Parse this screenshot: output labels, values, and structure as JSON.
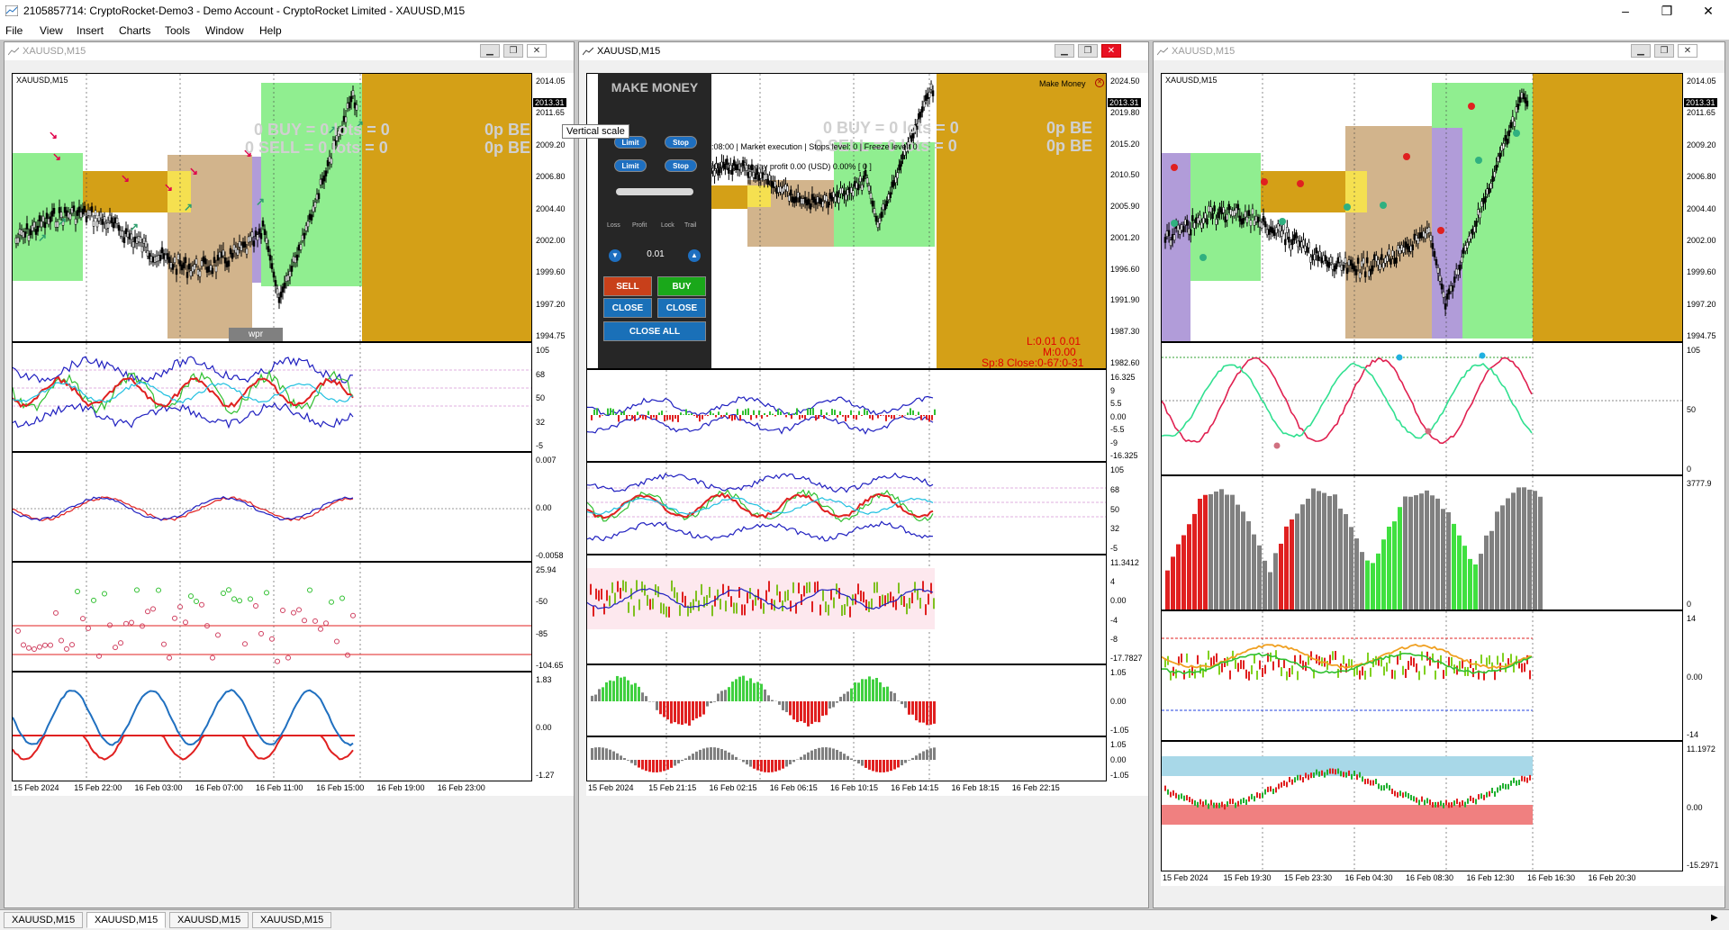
{
  "app": {
    "title": "2105857714: CryptoRocket-Demo3 - Demo Account - CryptoRocket Limited - XAUUSD,M15",
    "minimize": "–",
    "maximize": "❐",
    "close": "✕"
  },
  "menu": [
    "File",
    "View",
    "Insert",
    "Charts",
    "Tools",
    "Window",
    "Help"
  ],
  "colors": {
    "green_zone": "#90ee90",
    "orange_zone": "#d4a017",
    "tan_zone": "#d2b48c",
    "purple_zone": "#b19cd9",
    "bull": "#00c000",
    "bear": "#e00000"
  },
  "windows": [
    {
      "title": "XAUUSD,M15",
      "symbol_label": "XAUUSD,M15",
      "overlay": [
        "0 BUY = 0 lots = 0",
        "0 SELL = 0 lots = 0",
        "0p BE",
        "0p BE"
      ],
      "wpr_label": "wpr",
      "price_ticks": [
        "2014.05",
        "2011.65",
        "2009.20",
        "2006.80",
        "2004.40",
        "2002.00",
        "1999.60",
        "1997.20",
        "1994.75"
      ],
      "current_price": "2013.31",
      "ind1_ticks": [
        "105",
        "68",
        "50",
        "32",
        "-5"
      ],
      "ind1_extra": "00",
      "ind2_ticks": [
        "0.007",
        "0.00",
        "-0.0058"
      ],
      "ind3_ticks": [
        "25.94",
        "-50",
        "-85",
        "-104.65"
      ],
      "ind4_ticks": [
        "1.83",
        "0.00",
        "-1.27"
      ],
      "time_labels": [
        "15 Feb 2024",
        "15 Feb 22:00",
        "16 Feb 03:00",
        "16 Feb 07:00",
        "16 Feb 11:00",
        "16 Feb 15:00",
        "16 Feb 19:00",
        "16 Feb 23:00"
      ]
    },
    {
      "title": "XAUUSD,M15",
      "overlay": [
        "0 BUY = 0 lots = 0",
        "0 SELL = 0 lots = 0",
        "0p BE",
        "0p BE"
      ],
      "make_money_label": "Make Money",
      "info_line1": "01:08:00 | Market execution | Stops level: 0 | Freeze level: 0",
      "info_line2": "0.00% [ 0 ] | today profit 0.00 (USD)  0.00% [ 0 ]",
      "status": [
        "L:0.01 0.01",
        "M:0.00",
        "Sp:8   Close:0-67:0-31"
      ],
      "price_ticks": [
        "2024.50",
        "2019.80",
        "2015.20",
        "2010.50",
        "2005.90",
        "2001.20",
        "1996.60",
        "1991.90",
        "1987.30",
        "1982.60"
      ],
      "current_price": "2013.31",
      "ind1_ticks": [
        "16.325",
        "9",
        "5.5",
        "0.00",
        "-5.5",
        "-9",
        "-16.325"
      ],
      "ind2_ticks": [
        "105",
        "68",
        "50",
        "32",
        "-5"
      ],
      "ind2_extra": "00",
      "ind3_ticks": [
        "11.3412",
        "4",
        "0.00",
        "-4",
        "-8",
        "-17.7827"
      ],
      "ind4_ticks": [
        "1.05",
        "0.00",
        "-1.05"
      ],
      "ind5_ticks": [
        "1.05",
        "0.00",
        "-1.05"
      ],
      "time_labels": [
        "15 Feb 2024",
        "15 Feb 21:15",
        "16 Feb 02:15",
        "16 Feb 06:15",
        "16 Feb 10:15",
        "16 Feb 14:15",
        "16 Feb 18:15",
        "16 Feb 22:15"
      ]
    },
    {
      "title": "XAUUSD,M15",
      "symbol_label": "XAUUSD,M15",
      "price_ticks": [
        "2014.05",
        "2011.65",
        "2009.20",
        "2006.80",
        "2004.40",
        "2002.00",
        "1999.60",
        "1997.20",
        "1994.75"
      ],
      "current_price": "2013.31",
      "ind1_ticks": [
        "105",
        "50",
        "0"
      ],
      "ind2_ticks": [
        "3777.9",
        "0"
      ],
      "ind3_ticks": [
        "14",
        "0.00",
        "-14"
      ],
      "ind4_ticks": [
        "11.1972",
        "0.00",
        "-15.2971"
      ],
      "time_labels": [
        "15 Feb 2024",
        "15 Feb 19:30",
        "15 Feb 23:30",
        "16 Feb 04:30",
        "16 Feb 08:30",
        "16 Feb 12:30",
        "16 Feb 16:30",
        "16 Feb 20:30"
      ]
    }
  ],
  "panel": {
    "title": "MAKE MONEY",
    "btn_limit": "Limit",
    "btn_stop": "Stop",
    "btn_limit2": "Limit",
    "btn_stop2": "Stop",
    "tabs": [
      "Loss",
      "Profit",
      "Lock",
      "Trail"
    ],
    "lot": "0.01",
    "sell": "SELL",
    "buy": "BUY",
    "close1": "CLOSE",
    "close2": "CLOSE",
    "close_all": "CLOSE ALL"
  },
  "tooltip": "Vertical scale",
  "tabs": [
    "XAUUSD,M15",
    "XAUUSD,M15",
    "XAUUSD,M15",
    "XAUUSD,M15"
  ]
}
